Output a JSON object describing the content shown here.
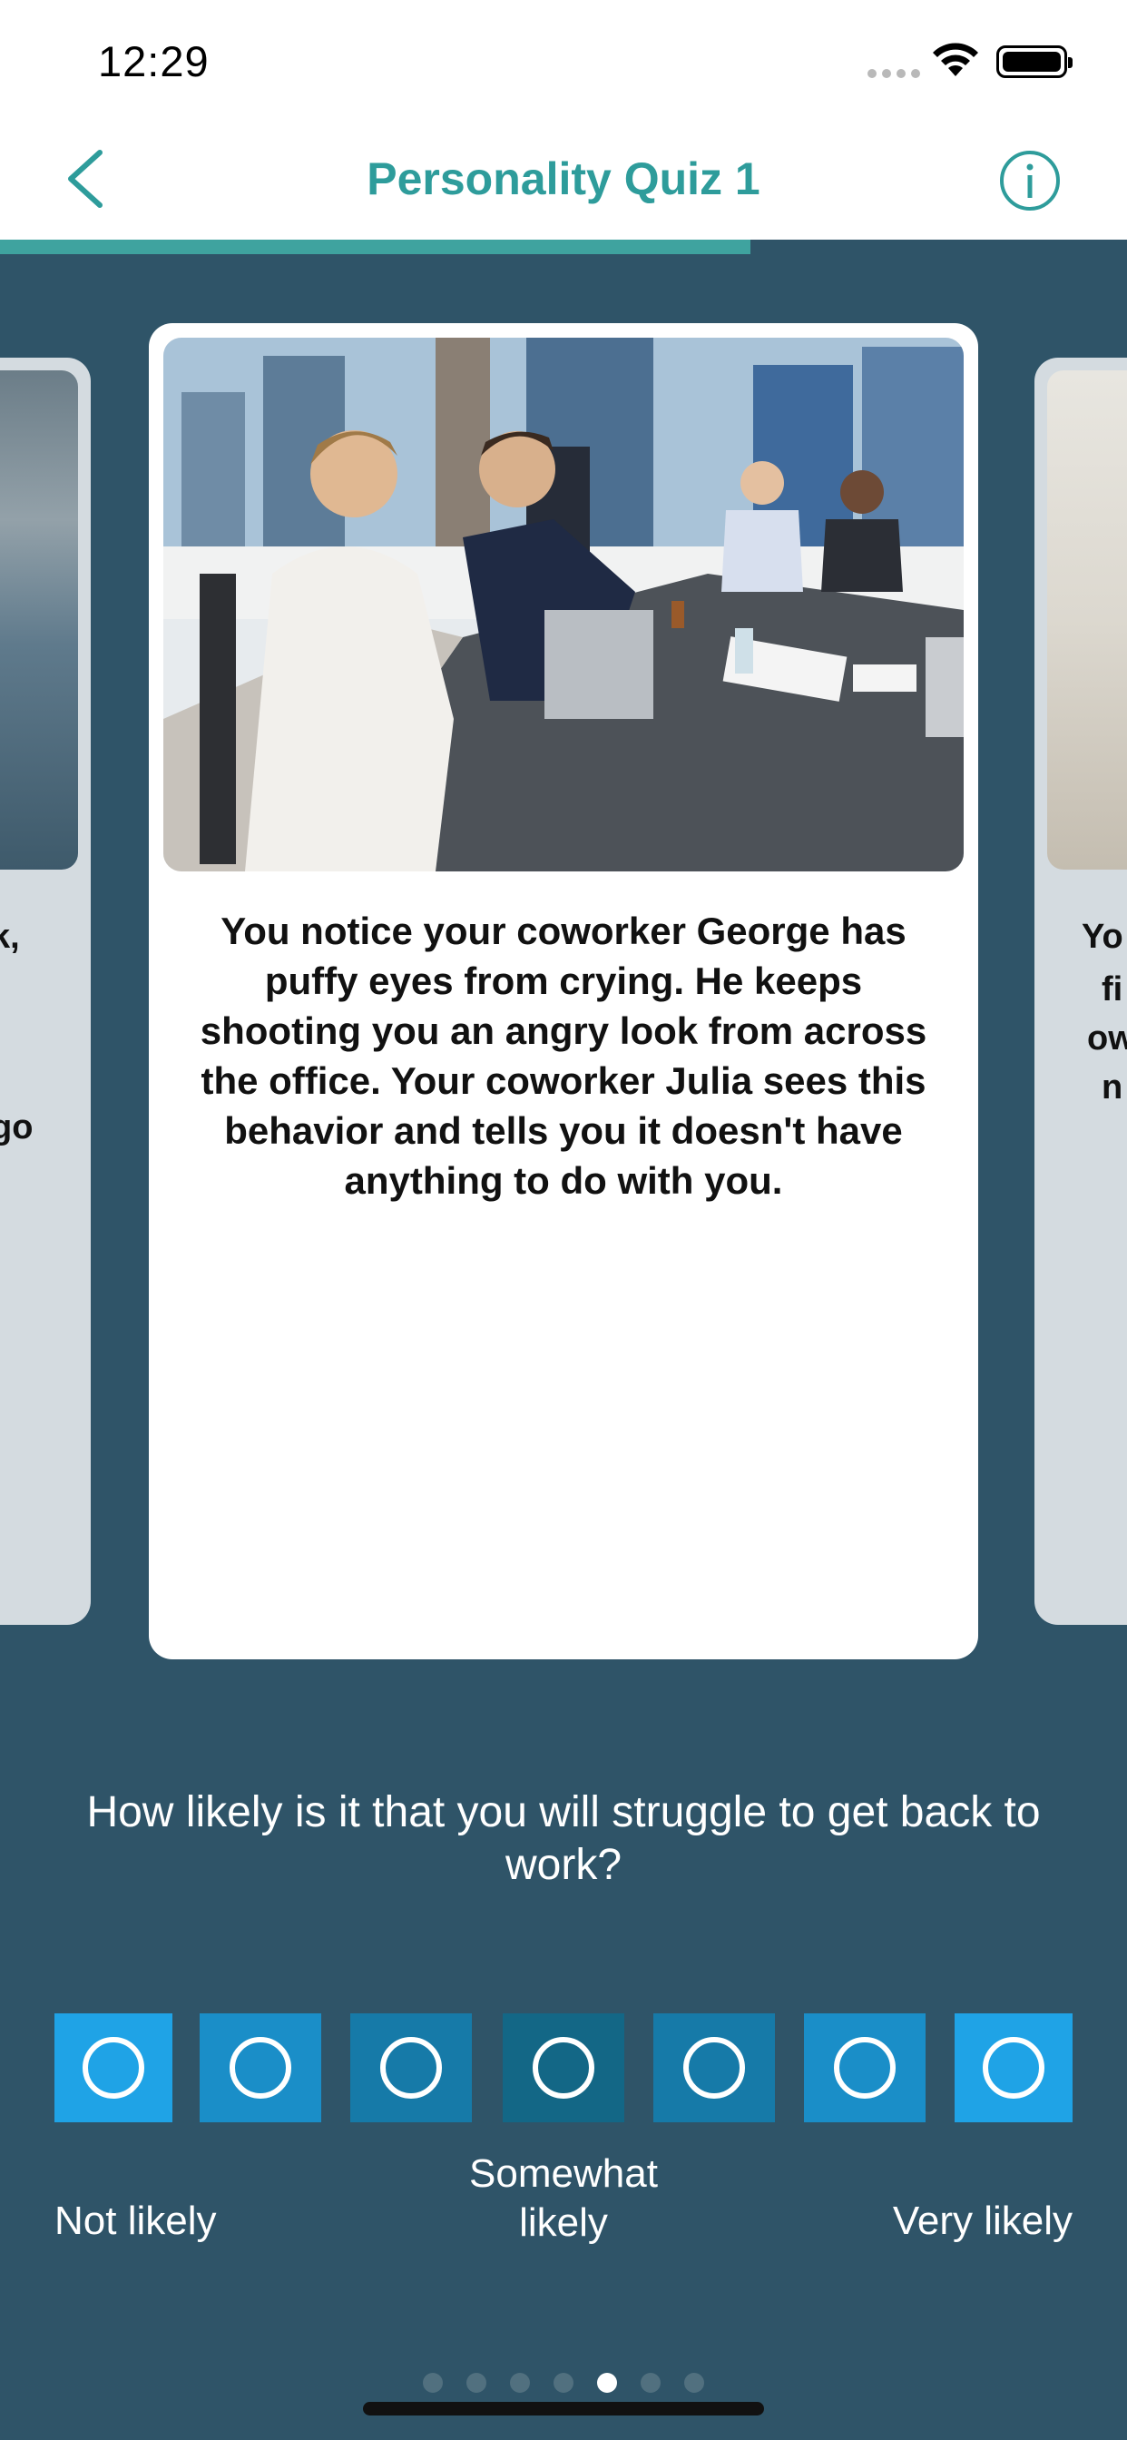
{
  "status_bar": {
    "time": "12:29"
  },
  "nav": {
    "title": "Personality Quiz 1"
  },
  "progress": {
    "fraction": 0.666
  },
  "colors": {
    "accent": "#2e9c9b",
    "background": "#2f5468"
  },
  "cards": {
    "left_fragment": [
      "k,",
      "go"
    ],
    "right_fragment": [
      "Yo",
      "fi",
      "ow",
      "n"
    ],
    "current": {
      "text": "You notice your coworker George has puffy eyes from crying. He keeps shooting you an angry look from across the office. Your coworker Julia sees this behavior and tells you it doesn't have anything to do with you."
    }
  },
  "question": "How likely is it that you will struggle to get back to work?",
  "scale": {
    "options": [
      {
        "color": "#1fa3e6"
      },
      {
        "color": "#1a8ec8"
      },
      {
        "color": "#167aa8"
      },
      {
        "color": "#136786"
      },
      {
        "color": "#167aa8"
      },
      {
        "color": "#1a8ec8"
      },
      {
        "color": "#1fa3e6"
      }
    ],
    "label_left": "Not likely",
    "label_middle": "Somewhat likely",
    "label_right": "Very likely"
  },
  "page_dots": {
    "count": 7,
    "active_index": 4
  }
}
